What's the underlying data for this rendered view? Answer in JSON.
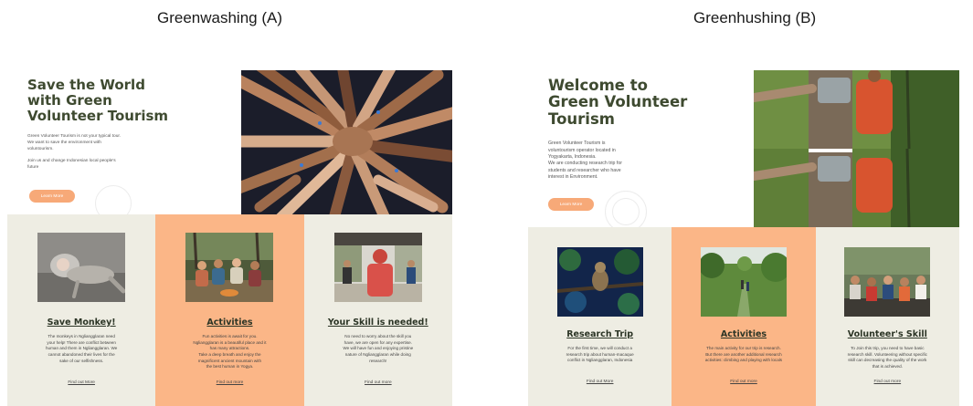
{
  "captions": {
    "a": "Greenwashing (A)",
    "b": "Greenhushing (B)"
  },
  "panel_a": {
    "hero": {
      "title": "Save the World\nwith Green\nVolunteer Tourism",
      "body": "Green Volunteer Tourism is not your typical tour.\nWe want to save the environment with\nvoluntourism.\n\nJoin us and change Indonesian local people's\nfuture",
      "button": "Learn More"
    },
    "cards": [
      {
        "title": "Save Monkey!",
        "body": "The monkeys in Ngliangglaran need\nyour help! There are conflict between\nhuman and them in Ngliangglaran. We\ncannot abandoned their lives for the\nsake of our selfishness.",
        "link": "Find out More"
      },
      {
        "title": "Activities",
        "body": "Fun activities is await for you.\nNgliangglaran is a beautiful place and it\nhas many attractions.\nTake a deep breath and enjoy the\nmagnificent ancient mountain with\nthe best human in Yogya.",
        "link": "Find out more"
      },
      {
        "title": "Your Skill is needed!",
        "body": "No need to worry about the skill you\nhave, we are open for any expertise.\nWe will have fun and enjoying pristine\nnature of Ngliangglaran while doing\nresearch!",
        "link": "Find out more"
      }
    ]
  },
  "panel_b": {
    "hero": {
      "title": "Welcome to\nGreen Volunteer\nTourism",
      "body": "Green Volunteer Tourism is\nvoluntourism operator located in\nYogyakarta, Indonesia.\nWe are conducting research trip for\nstudents and researcher who have\ninterest in Environment.",
      "button": "Learn More"
    },
    "cards": [
      {
        "title": "Research Trip",
        "body": "For the first time, we will conduct a\nresearch trip about human-macaque\nconflict in Ngliangglaran, Indonesia",
        "link": "Find out More"
      },
      {
        "title": "Activities",
        "body": "The main activity for our trip is research.\nBut there are another additional research\nactivities: climbing and playing with locals",
        "link": "Find out more"
      },
      {
        "title": "Volunteer's Skill",
        "body": "To Join this trip, you need to have basic\nresearch skill. Volunteering without specific\nskill can decreasing the quality of the work\nthat is achieved.",
        "link": "Find out more"
      }
    ]
  },
  "colors": {
    "hero_title": "#3e4a30",
    "button": "#f7a978",
    "card_orange": "#fbb687",
    "card_beige": "#eeede3"
  }
}
